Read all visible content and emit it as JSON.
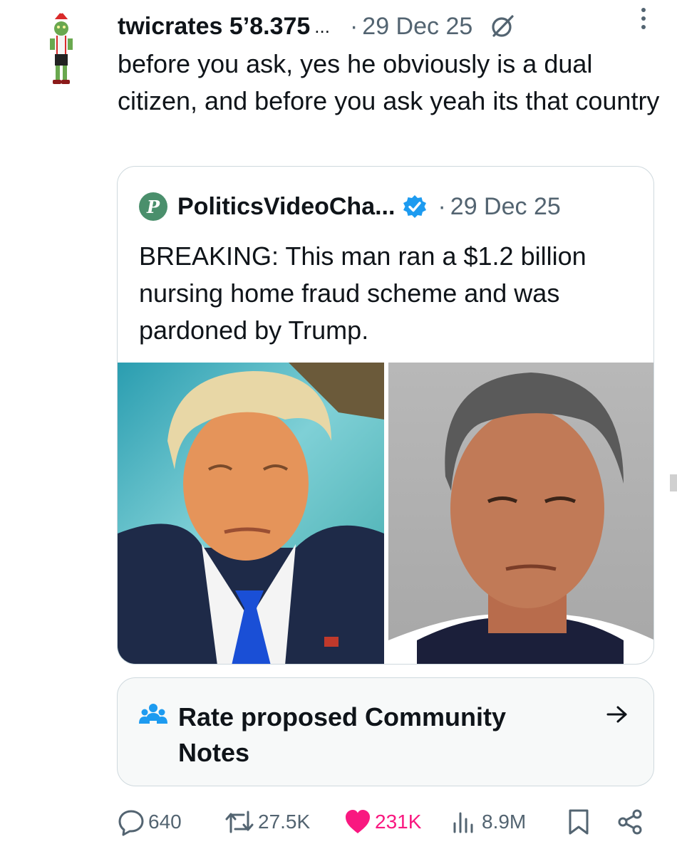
{
  "post": {
    "display_name": "twicrates 5’8.375",
    "name_ellipsis": "...",
    "separator": "·",
    "date": "29 Dec 25",
    "text": "before you ask, yes he obviously is a dual citizen, and before you ask yeah its that country"
  },
  "quote": {
    "avatar_letter": "P",
    "display_name": "PoliticsVideoCha...",
    "separator": "·",
    "date": "29 Dec 25",
    "text": "BREAKING: This man ran a $1.2 billion nursing home fraud scheme and was pardoned by Trump."
  },
  "community_notes": {
    "label": "Rate proposed Community Notes"
  },
  "actions": {
    "replies": "640",
    "reposts": "27.5K",
    "likes": "231K",
    "views": "8.9M"
  },
  "colors": {
    "text": "#0f1419",
    "secondary": "#536471",
    "border": "#cfd9de",
    "verified": "#1d9bf0",
    "like": "#f91880",
    "notes_icon": "#1d9bf0"
  },
  "icons": [
    "grok-icon",
    "more-icon",
    "verified-icon",
    "people-icon",
    "arrow-right-icon",
    "reply-icon",
    "repost-icon",
    "like-icon",
    "views-icon",
    "bookmark-icon",
    "share-icon"
  ]
}
